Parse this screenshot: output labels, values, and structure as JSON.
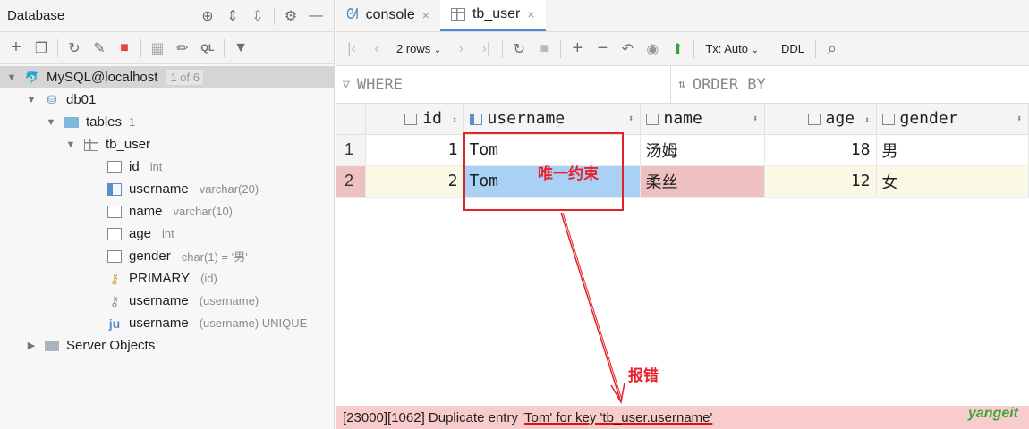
{
  "left_panel": {
    "title": "Database",
    "tree": {
      "connection": {
        "label": "MySQL@localhost",
        "badge": "1 of 6"
      },
      "schema": {
        "label": "db01"
      },
      "tables_folder": {
        "label": "tables",
        "count": "1"
      },
      "table": {
        "label": "tb_user"
      },
      "columns": [
        {
          "name": "id",
          "type": "int"
        },
        {
          "name": "username",
          "type": "varchar(20)"
        },
        {
          "name": "name",
          "type": "varchar(10)"
        },
        {
          "name": "age",
          "type": "int"
        },
        {
          "name": "gender",
          "type": "char(1) = '男'"
        }
      ],
      "keys": [
        {
          "name": "PRIMARY",
          "detail": "(id)"
        },
        {
          "name": "username",
          "detail": "(username)"
        },
        {
          "name": "username",
          "detail": "(username) UNIQUE"
        }
      ],
      "server_objects": {
        "label": "Server Objects"
      }
    }
  },
  "editor": {
    "tabs": [
      {
        "label": "console"
      },
      {
        "label": "tb_user"
      }
    ],
    "toolbar": {
      "rows": "2 rows",
      "tx": "Tx: Auto",
      "ddl": "DDL"
    },
    "filter": {
      "where": "WHERE",
      "order_by": "ORDER BY"
    },
    "grid": {
      "columns": [
        "id",
        "username",
        "name",
        "age",
        "gender"
      ],
      "rows": [
        {
          "rownum": "1",
          "id": "1",
          "username": "Tom",
          "name": "汤姆",
          "age": "18",
          "gender": "男"
        },
        {
          "rownum": "2",
          "id": "2",
          "username": "Tom",
          "name": "柔丝",
          "age": "12",
          "gender": "女"
        }
      ]
    },
    "error": {
      "prefix": "[23000][1062] Duplicate entry '",
      "entry": "Tom",
      "mid": "' for key '",
      "key": "tb_user.username",
      "suffix": "'"
    }
  },
  "annotations": {
    "unique_constraint": "唯一约束",
    "error": "报错"
  },
  "brand": "yangeit",
  "colors": {
    "accent": "#4a8ad6",
    "error_bg": "#f8cccc",
    "annotation": "#e8222a",
    "selection": "#a9d0f5"
  }
}
